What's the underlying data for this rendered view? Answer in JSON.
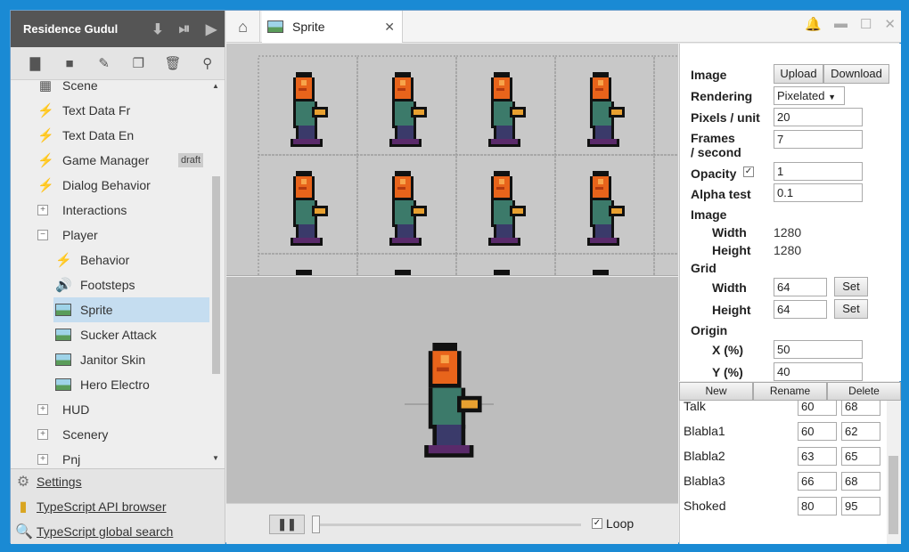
{
  "project": {
    "title": "Residence Gudul"
  },
  "tree": [
    {
      "label": "Scene",
      "kind": "scene",
      "indent": 1
    },
    {
      "label": "Text Data Fr",
      "kind": "bolt",
      "indent": 1
    },
    {
      "label": "Text Data En",
      "kind": "bolt",
      "indent": 1
    },
    {
      "label": "Game Manager",
      "kind": "bolt",
      "indent": 1,
      "badge": "draft"
    },
    {
      "label": "Dialog Behavior",
      "kind": "bolt",
      "indent": 1
    },
    {
      "label": "Interactions",
      "kind": "folder-closed",
      "indent": 1
    },
    {
      "label": "Player",
      "kind": "folder-open",
      "indent": 1
    },
    {
      "label": "Behavior",
      "kind": "bolt",
      "indent": 2
    },
    {
      "label": "Footsteps",
      "kind": "sound",
      "indent": 2
    },
    {
      "label": "Sprite",
      "kind": "sprite",
      "indent": 2,
      "selected": true
    },
    {
      "label": "Sucker Attack",
      "kind": "sprite",
      "indent": 2
    },
    {
      "label": "Janitor Skin",
      "kind": "sprite",
      "indent": 2
    },
    {
      "label": "Hero Electro",
      "kind": "sprite",
      "indent": 2
    },
    {
      "label": "HUD",
      "kind": "folder-closed",
      "indent": 1
    },
    {
      "label": "Scenery",
      "kind": "folder-closed",
      "indent": 1
    },
    {
      "label": "Pnj",
      "kind": "folder-closed",
      "indent": 1
    }
  ],
  "footer_links": {
    "settings": "Settings",
    "api": "TypeScript API browser",
    "search": "TypeScript global search"
  },
  "tab": {
    "label": "Sprite"
  },
  "player": {
    "loop": "Loop"
  },
  "props": {
    "image_label": "Image",
    "upload": "Upload",
    "download": "Download",
    "rendering_label": "Rendering",
    "rendering_value": "Pixelated",
    "ppu_label": "Pixels / unit",
    "ppu_value": "20",
    "fps_label1": "Frames",
    "fps_label2": "/ second",
    "fps_value": "7",
    "opacity_label": "Opacity",
    "opacity_value": "1",
    "alpha_label": "Alpha test",
    "alpha_value": "0.1",
    "img_label": "Image",
    "width_label": "Width",
    "width_value": "1280",
    "height_label": "Height",
    "height_value": "1280",
    "grid_label": "Grid",
    "gwidth_label": "Width",
    "gwidth_value": "64",
    "gheight_label": "Height",
    "gheight_value": "64",
    "set": "Set",
    "origin_label": "Origin",
    "ox_label": "X (%)",
    "ox_value": "50",
    "oy_label": "Y (%)",
    "oy_value": "40"
  },
  "animbar": {
    "new": "New",
    "rename": "Rename",
    "delete": "Delete"
  },
  "animations": [
    {
      "name": "Talk",
      "start": "60",
      "end": "68"
    },
    {
      "name": "Blabla1",
      "start": "60",
      "end": "62"
    },
    {
      "name": "Blabla2",
      "start": "63",
      "end": "65"
    },
    {
      "name": "Blabla3",
      "start": "66",
      "end": "68"
    },
    {
      "name": "Shoked",
      "start": "80",
      "end": "95"
    }
  ]
}
